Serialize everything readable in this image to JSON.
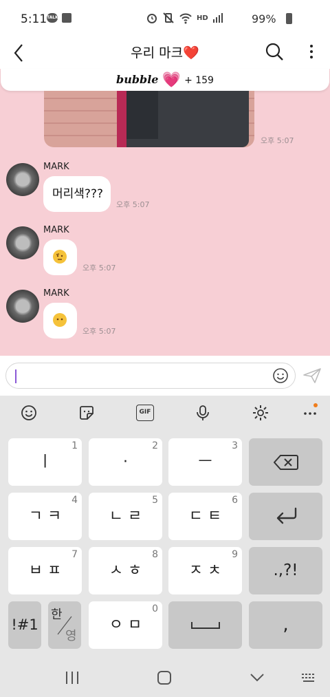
{
  "status_bar": {
    "time": "5:11",
    "talk_badge": "TALK",
    "hd_label": "HD",
    "battery_text": "99%"
  },
  "header": {
    "title": "우리 마크",
    "title_emoji": "❤️"
  },
  "bubble_banner": {
    "logo": "bubble",
    "heart": "💗",
    "count": "+ 159"
  },
  "messages": [
    {
      "time": "오후 5:07"
    },
    {
      "sender": "MARK",
      "text": "머리색???",
      "time": "오후 5:07"
    },
    {
      "sender": "MARK",
      "emoji": "🤨",
      "time": "오후 5:07"
    },
    {
      "sender": "MARK",
      "emoji": "😶",
      "time": "오후 5:07"
    }
  ],
  "input": {
    "value": "",
    "placeholder": ""
  },
  "keyboard": {
    "toolbar_gif": "GIF",
    "rows": [
      [
        {
          "label": "ㅣ",
          "num": "1"
        },
        {
          "label": "·",
          "num": "2"
        },
        {
          "label": "ㅡ",
          "num": "3"
        }
      ],
      [
        {
          "label": "ㄱ ㅋ",
          "num": "4"
        },
        {
          "label": "ㄴ ㄹ",
          "num": "5"
        },
        {
          "label": "ㄷ ㅌ",
          "num": "6"
        }
      ],
      [
        {
          "label": "ㅂ ㅍ",
          "num": "7"
        },
        {
          "label": "ㅅ ㅎ",
          "num": "8"
        },
        {
          "label": "ㅈ ㅊ",
          "num": "9"
        }
      ]
    ],
    "punct_key": ".,?!",
    "symbol_key": "!#1",
    "lang_top": "한",
    "lang_bottom": "영",
    "zero_key": {
      "label": "ㅇ ㅁ",
      "num": "0"
    },
    "comma_key": ","
  },
  "icons": {
    "accent": "#8a58d6",
    "notification_dot": "#f07d1c",
    "chat_background": "#f7cfd5",
    "bubble_heart": "#e8379c"
  }
}
